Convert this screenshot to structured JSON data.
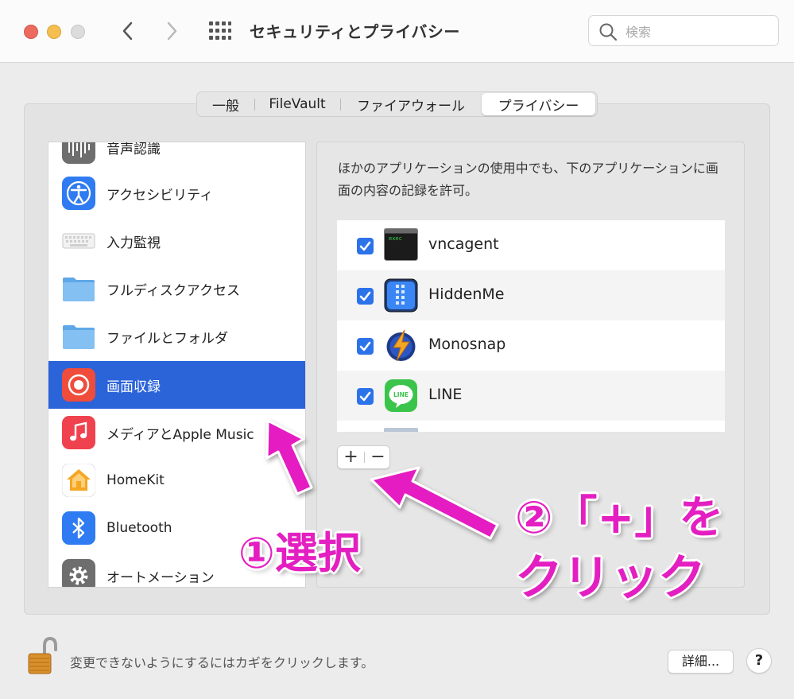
{
  "window": {
    "title": "セキュリティとプライバシー"
  },
  "search": {
    "placeholder": "検索"
  },
  "tabs": [
    {
      "label": "一般"
    },
    {
      "label": "FileVault"
    },
    {
      "label": "ファイアウォール"
    },
    {
      "label": "プライバシー",
      "active": true
    }
  ],
  "sidebar": {
    "items": [
      {
        "label": "音声認識",
        "icon": "waveform-icon"
      },
      {
        "label": "アクセシビリティ",
        "icon": "accessibility-icon"
      },
      {
        "label": "入力監視",
        "icon": "keyboard-icon"
      },
      {
        "label": "フルディスクアクセス",
        "icon": "folder-icon"
      },
      {
        "label": "ファイルとフォルダ",
        "icon": "folder-icon"
      },
      {
        "label": "画面収録",
        "icon": "screen-record-icon",
        "selected": true
      },
      {
        "label": "メディアとApple Music",
        "icon": "music-icon"
      },
      {
        "label": "HomeKit",
        "icon": "home-icon"
      },
      {
        "label": "Bluetooth",
        "icon": "bluetooth-icon"
      },
      {
        "label": "オートメーション",
        "icon": "gear-icon"
      }
    ]
  },
  "main": {
    "description": "ほかのアプリケーションの使用中でも、下のアプリケーションに画面の内容の記録を許可。",
    "apps": [
      {
        "name": "vncagent",
        "checked": true,
        "icon": "terminal-exec-icon",
        "icon_text": "exec"
      },
      {
        "name": "HiddenMe",
        "checked": true,
        "icon": "hiddenme-icon"
      },
      {
        "name": "Monosnap",
        "checked": true,
        "icon": "monosnap-icon"
      },
      {
        "name": "LINE",
        "checked": true,
        "icon": "line-icon",
        "icon_text": "LINE"
      }
    ],
    "add_label": "+",
    "remove_label": "−"
  },
  "footer": {
    "lock_text": "変更できないようにするにはカギをクリックします。",
    "detail_label": "詳細...",
    "help_label": "?"
  },
  "annotations": {
    "step1": "①選択",
    "step2_line1": "②「+」を",
    "step2_line2": "クリック"
  },
  "colors": {
    "selection": "#2b63d9",
    "checkbox": "#2c73ea",
    "annotation": "#e41fc1"
  }
}
